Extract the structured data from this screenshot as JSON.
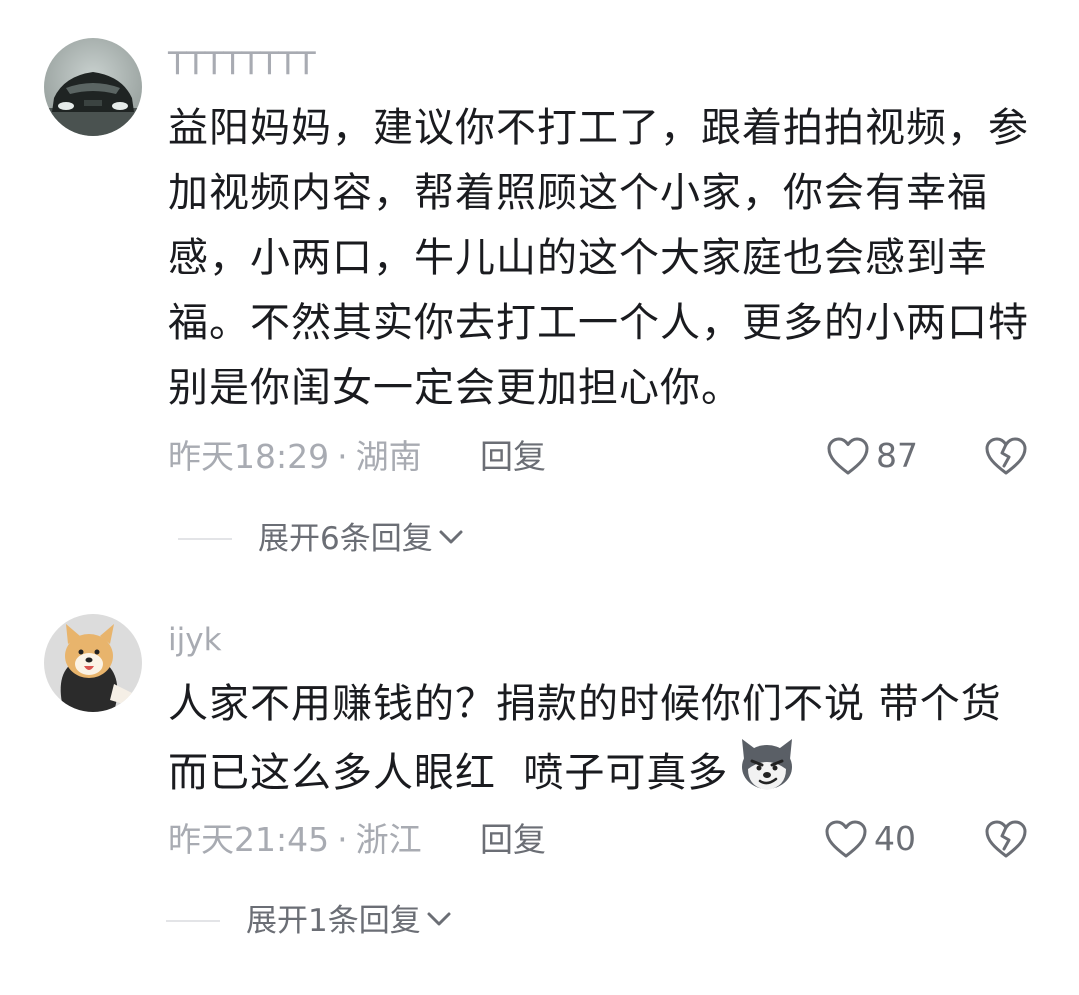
{
  "comments": [
    {
      "username": "TTTTTTTT",
      "lines": [
        "益阳妈妈，建议你不打工了，跟着拍拍视频，参",
        "加视频内容，帮着照顾这个小家，你会有幸福",
        "感，小两口，牛儿山的这个大家庭也会感到幸",
        "福。不然其实你去打工一个人，更多的小两口特",
        "别是你闺女一定会更加担心你。"
      ],
      "time": "昨天18:29",
      "separator": "·",
      "location": "湖南",
      "reply_label": "回复",
      "likes": "87",
      "expand_label": "展开6条回复",
      "avatar_icon": "car-avatar-icon"
    },
    {
      "username": "ijyk",
      "lines": [
        "人家不用赚钱的？捐款的时候你们不说 带个货",
        "而已这么多人眼红  喷子可真多"
      ],
      "time": "昨天21:45",
      "separator": "·",
      "location": "浙江",
      "reply_label": "回复",
      "likes": "40",
      "expand_label": "展开1条回复",
      "avatar_icon": "shiba-dog-avatar-icon",
      "emoji_icon": "husky-smirk-emoji-icon"
    }
  ],
  "colors": {
    "text_primary": "#1a1b1f",
    "text_secondary": "#a8abb2",
    "text_action": "#6b6e75",
    "divider": "#e3e4e7"
  }
}
